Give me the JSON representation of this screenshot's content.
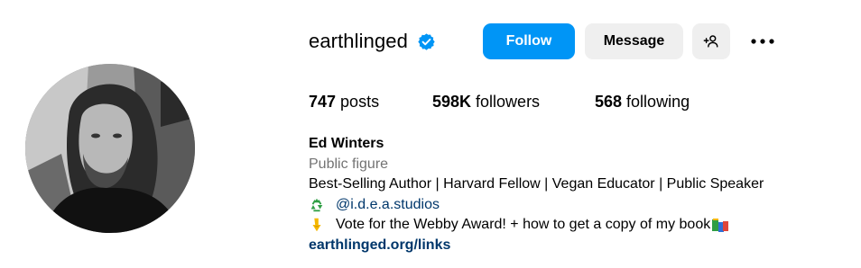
{
  "profile": {
    "username": "earthlinged",
    "verified": true,
    "full_name": "Ed Winters",
    "category": "Public figure",
    "bio_line": "Best-Selling Author | Harvard Fellow | Vegan Educator | Public Speaker",
    "threads_handle": "@i.d.e.a.studios",
    "cta_text": "Vote for the Webby Award! + how to get a copy of my book",
    "link": "earthlinged.org/links"
  },
  "actions": {
    "follow_label": "Follow",
    "message_label": "Message"
  },
  "stats": {
    "posts_count": "747",
    "posts_label": " posts",
    "followers_count": "598K",
    "followers_label": " followers",
    "following_count": "568",
    "following_label": " following"
  },
  "icons": {
    "verified": "verified-badge-icon",
    "add_user": "add-user-icon",
    "more": "more-options-icon",
    "recycle": "recycle-icon",
    "pointing_down": "pointing-down-emoji",
    "books": "books-emoji"
  },
  "colors": {
    "primary": "#0095f6",
    "secondary_button": "#efefef",
    "link": "#00376b",
    "muted_text": "#737373"
  }
}
